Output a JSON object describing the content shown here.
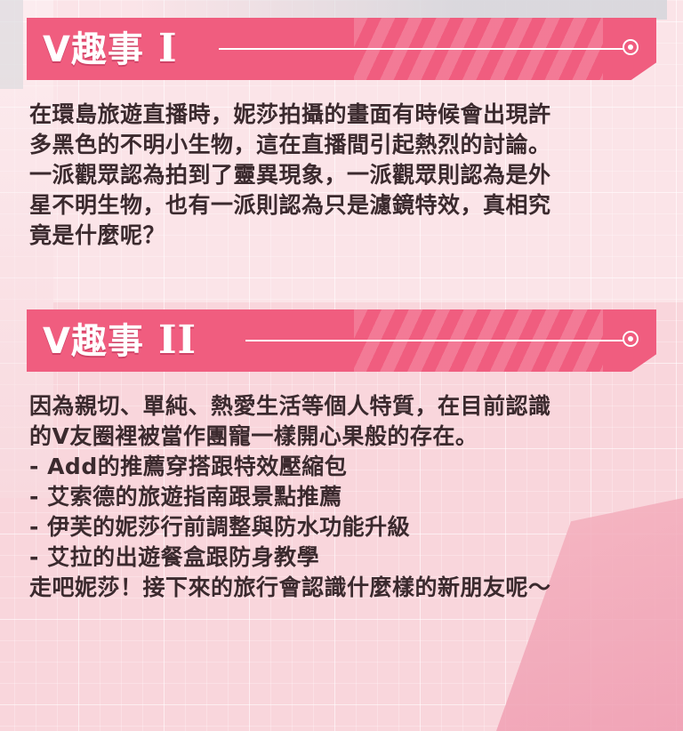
{
  "section1": {
    "title": "V趣事",
    "numeral": "I",
    "lines": [
      "在環島旅遊直播時，妮莎拍攝的畫面有時候會出現許",
      "多黑色的不明小生物，這在直播間引起熱烈的討論。",
      "一派觀眾認為拍到了靈異現象，一派觀眾則認為是外",
      "星不明生物，也有一派則認為只是濾鏡特效，真相究",
      "竟是什麼呢？"
    ]
  },
  "section2": {
    "title": "V趣事",
    "numeral": "II",
    "lines": [
      "因為親切、單純、熱愛生活等個人特質，在目前認識",
      "的V友圈裡被當作團寵一樣開心果般的存在。",
      "- Add的推薦穿搭跟特效壓縮包",
      "- 艾索德的旅遊指南跟景點推薦",
      "- 伊芙的妮莎行前調整與防水功能升級",
      "- 艾拉的出遊餐盒跟防身教學",
      "走吧妮莎！接下來的旅行會認識什麼樣的新朋友呢～"
    ]
  },
  "colors": {
    "header": "#f05d7f",
    "text": "#3b2a2e",
    "background": "#f9d6dc"
  },
  "icons": {
    "header_end": "target-dot-icon"
  }
}
